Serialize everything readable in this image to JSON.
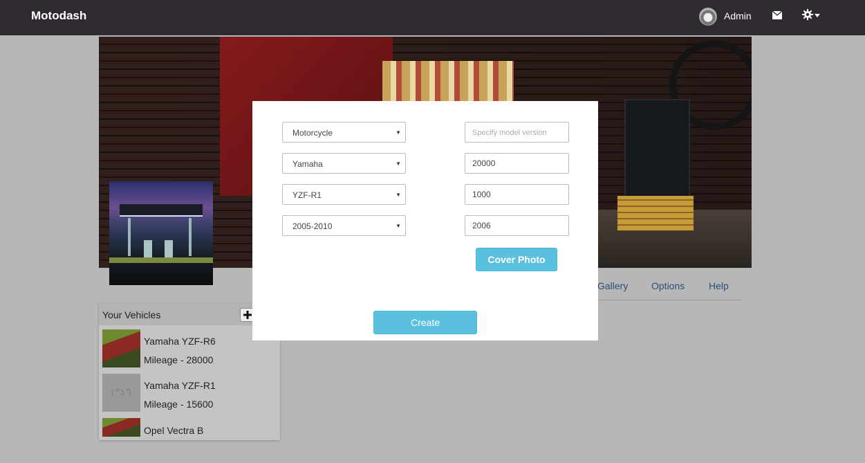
{
  "navbar": {
    "brand": "Motodash",
    "user_name": "Admin",
    "icons": [
      "avatar",
      "mail-icon",
      "gear-icon",
      "caret-down-icon"
    ]
  },
  "profile": {
    "tabs": [
      "Gallery",
      "Options",
      "Help"
    ]
  },
  "vehicles": {
    "title": "Your Vehicles",
    "add_icon": "plus-icon",
    "items": [
      {
        "name": "Yamaha YZF-R6",
        "mileage": "Mileage - 28000"
      },
      {
        "name": "Yamaha YZF-R1",
        "mileage": "Mileage - 15600",
        "placeholder_face": "( ͡° ͜ʖ ͡°)"
      },
      {
        "name": "Opel Vectra B"
      }
    ]
  },
  "modal": {
    "selects": {
      "type": "Motorcycle",
      "make": "Yamaha",
      "model": "YZF-R1",
      "years": "2005-2010"
    },
    "inputs": {
      "model_version_placeholder": "Specify model version",
      "field_2": "20000",
      "field_3": "1000",
      "year": "2006"
    },
    "cover_photo_label": "Cover Photo",
    "create_label": "Create"
  },
  "colors": {
    "navbar_bg": "#2e2a2f",
    "page_bg": "#b7b7b7",
    "button_info": "#5bc0de",
    "tab_link": "#2a4e73"
  }
}
